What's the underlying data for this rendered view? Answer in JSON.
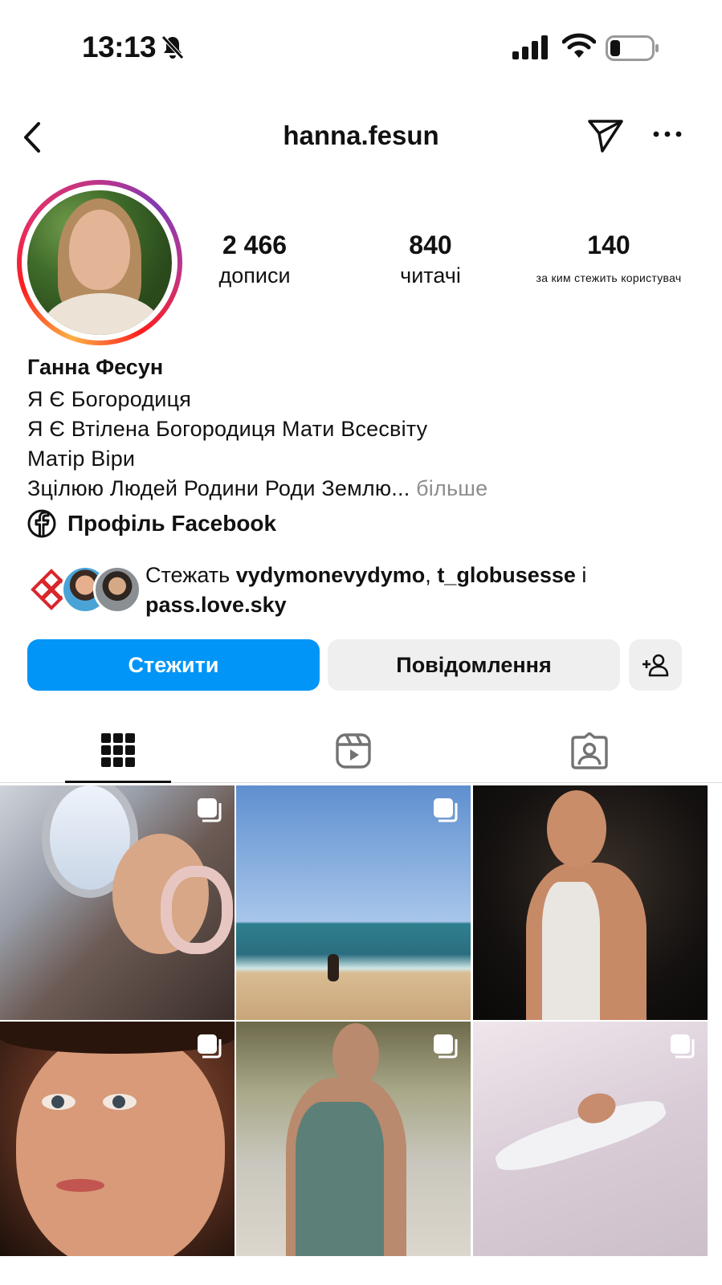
{
  "status_bar": {
    "time": "13:13"
  },
  "header": {
    "username": "hanna.fesun"
  },
  "stats": [
    {
      "value": "2 466",
      "label": "дописи"
    },
    {
      "value": "840",
      "label": "читачі"
    },
    {
      "value": "140",
      "label": "за ким стежить користувач"
    }
  ],
  "bio": {
    "name": "Ганна Фесун",
    "lines": [
      "Я Є Богородиця",
      "Я Є Втілена Богородиця Мати Всесвіту",
      "Матір Віри",
      "Зцілюю Людей Родини Роди Землю..."
    ],
    "more_label": "більше",
    "facebook_label": "Профіль Facebook"
  },
  "followed_by": {
    "prefix": "Стежать ",
    "user_1": "vydymonevydymo",
    "separator": ", ",
    "user_2": "t_globusesse",
    "conjunction": " і",
    "user_3": "pass.love.sky"
  },
  "actions": {
    "follow_label": "Стежити",
    "message_label": "Повідомлення"
  },
  "colors": {
    "follow_button": "#0095f6",
    "secondary_button": "#efefef",
    "more_text": "#8e8e8e"
  },
  "icons": [
    "back-icon",
    "send-icon",
    "more-icon",
    "facebook-icon",
    "add-user-icon",
    "grid-icon",
    "reels-icon",
    "tagged-icon",
    "multiple-photos-icon"
  ]
}
